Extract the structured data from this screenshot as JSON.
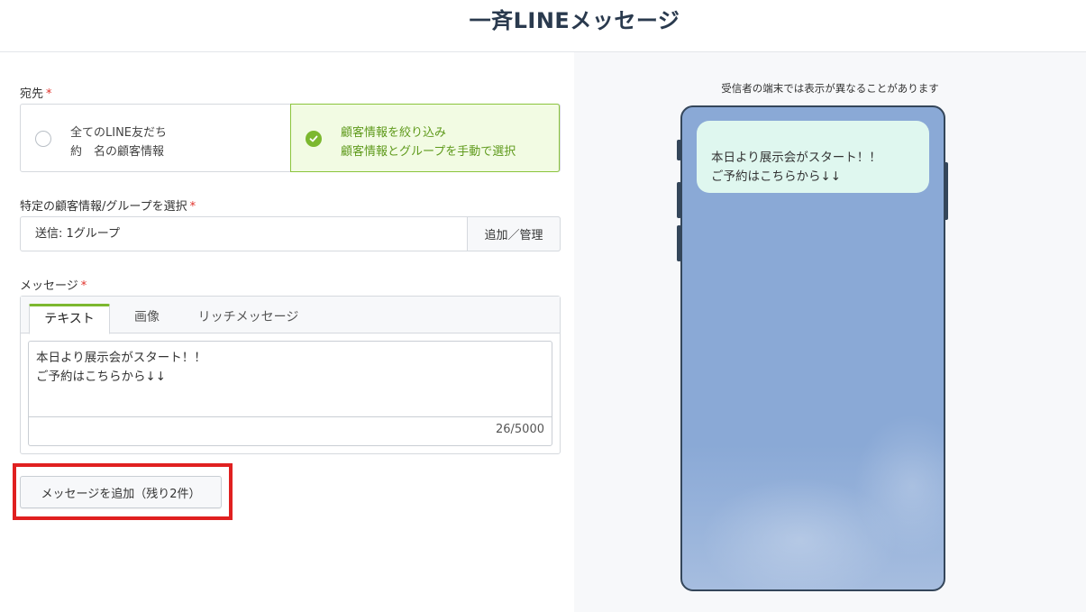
{
  "header": {
    "title": "一斉LINEメッセージ"
  },
  "recipient": {
    "label": "宛先",
    "required_mark": "*",
    "options": [
      {
        "line1": "全てのLINE友だち",
        "line2": "約　名の顧客情報",
        "selected": false
      },
      {
        "line1": "顧客情報を絞り込み",
        "line2": "顧客情報とグループを手動で選択",
        "selected": true
      }
    ]
  },
  "group_select": {
    "label": "特定の顧客情報/グループを選択",
    "required_mark": "*",
    "value": "送信: 1グループ",
    "button_label": "追加／管理"
  },
  "message": {
    "label": "メッセージ",
    "required_mark": "*",
    "tabs": [
      {
        "label": "テキスト",
        "active": true
      },
      {
        "label": "画像",
        "active": false
      },
      {
        "label": "リッチメッセージ",
        "active": false
      }
    ],
    "text": "本日より展示会がスタート！！\nご予約はこちらから↓↓",
    "char_count": "26/5000"
  },
  "add_message": {
    "label": "メッセージを追加（残り2件）"
  },
  "preview": {
    "note": "受信者の端末では表示が異なることがあります",
    "bubble_text": "本日より展示会がスタート！！\nご予約はこちらから↓↓"
  },
  "colors": {
    "accent_green": "#7cb82f",
    "highlight_red": "#e02020",
    "phone_bg": "#8aa9d6",
    "bubble_bg": "#dff7ef"
  }
}
